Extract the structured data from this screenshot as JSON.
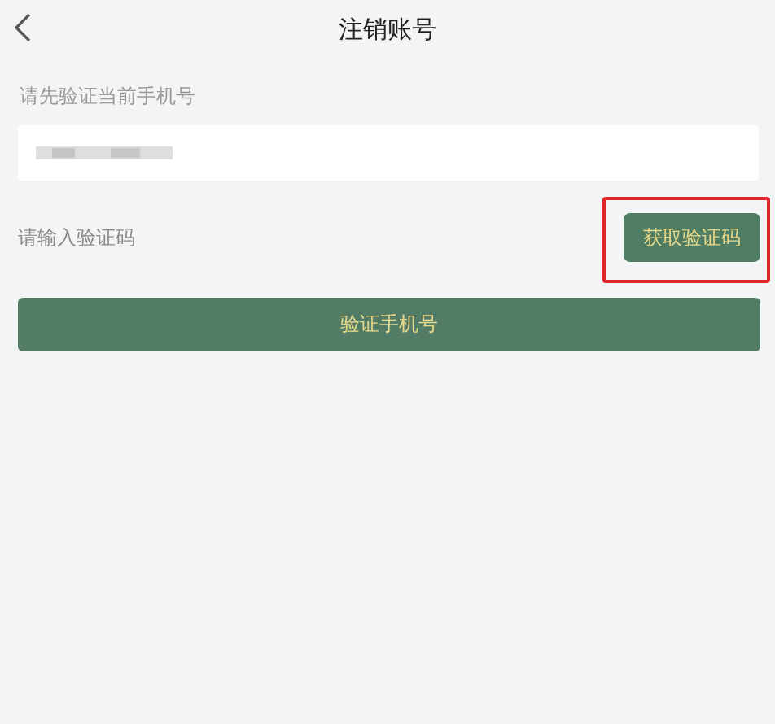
{
  "header": {
    "title": "注销账号"
  },
  "phone": {
    "label": "请先验证当前手机号"
  },
  "code": {
    "placeholder": "请输入验证码",
    "button": {
      "label": "获取验证码",
      "highlighted": true
    }
  },
  "submit": {
    "label": "验证手机号"
  }
}
